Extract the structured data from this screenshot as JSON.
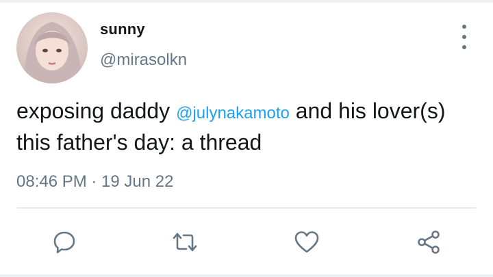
{
  "tweet": {
    "author": {
      "display_name": "sunny",
      "handle": "@mirasolkn",
      "avatar_icon": "profile-photo"
    },
    "text_before_mention": "exposing daddy ",
    "mention": "@julynakamoto",
    "text_after_mention": " and his lover(s) this father's day: a thread",
    "timestamp": "08:46 PM · 19 Jun 22"
  },
  "actions": [
    {
      "name": "reply",
      "icon": "comment-bubble-icon"
    },
    {
      "name": "retweet",
      "icon": "retweet-arrows-icon"
    },
    {
      "name": "like",
      "icon": "heart-icon"
    },
    {
      "name": "share",
      "icon": "share-nodes-icon"
    }
  ],
  "more_icon": "vertical-ellipsis-icon",
  "colors": {
    "mention": "#1da1f2",
    "secondary_text": "#657786",
    "icon": "#657786",
    "divider": "#e6ecf0"
  }
}
